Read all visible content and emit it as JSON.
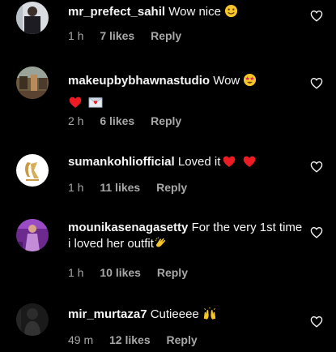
{
  "comments": [
    {
      "username": "mr_prefect_sahil",
      "text": "Wow nice",
      "time": "1 h",
      "likes": "7 likes",
      "reply": "Reply"
    },
    {
      "username": "makeupbybhawnastudio",
      "text": "Wow",
      "time": "2 h",
      "likes": "6 likes",
      "reply": "Reply"
    },
    {
      "username": "sumankohliofficial",
      "text": "Loved it",
      "time": "1 h",
      "likes": "11 likes",
      "reply": "Reply"
    },
    {
      "username": "mounikasenagasetty",
      "text": "For the very 1st time i loved her outfit",
      "time": "1 h",
      "likes": "10 likes",
      "reply": "Reply"
    },
    {
      "username": "mir_murtaza7",
      "text": "Cutieeee",
      "time": "49 m",
      "likes": "12 likes",
      "reply": "Reply"
    }
  ],
  "icons": {
    "like": "heart-outline-icon",
    "emoji_smile": "smiling-face-emoji",
    "emoji_star_eyes": "star-struck-emoji",
    "emoji_heart": "red-heart-emoji",
    "emoji_love_letter": "love-letter-emoji",
    "emoji_clap": "clapping-hands-emoji",
    "emoji_raised": "raising-hands-emoji"
  },
  "colors": {
    "background": "#000000",
    "text": "#f5f5f5",
    "meta": "#a8a8a8",
    "heart": "#ed1c24"
  }
}
